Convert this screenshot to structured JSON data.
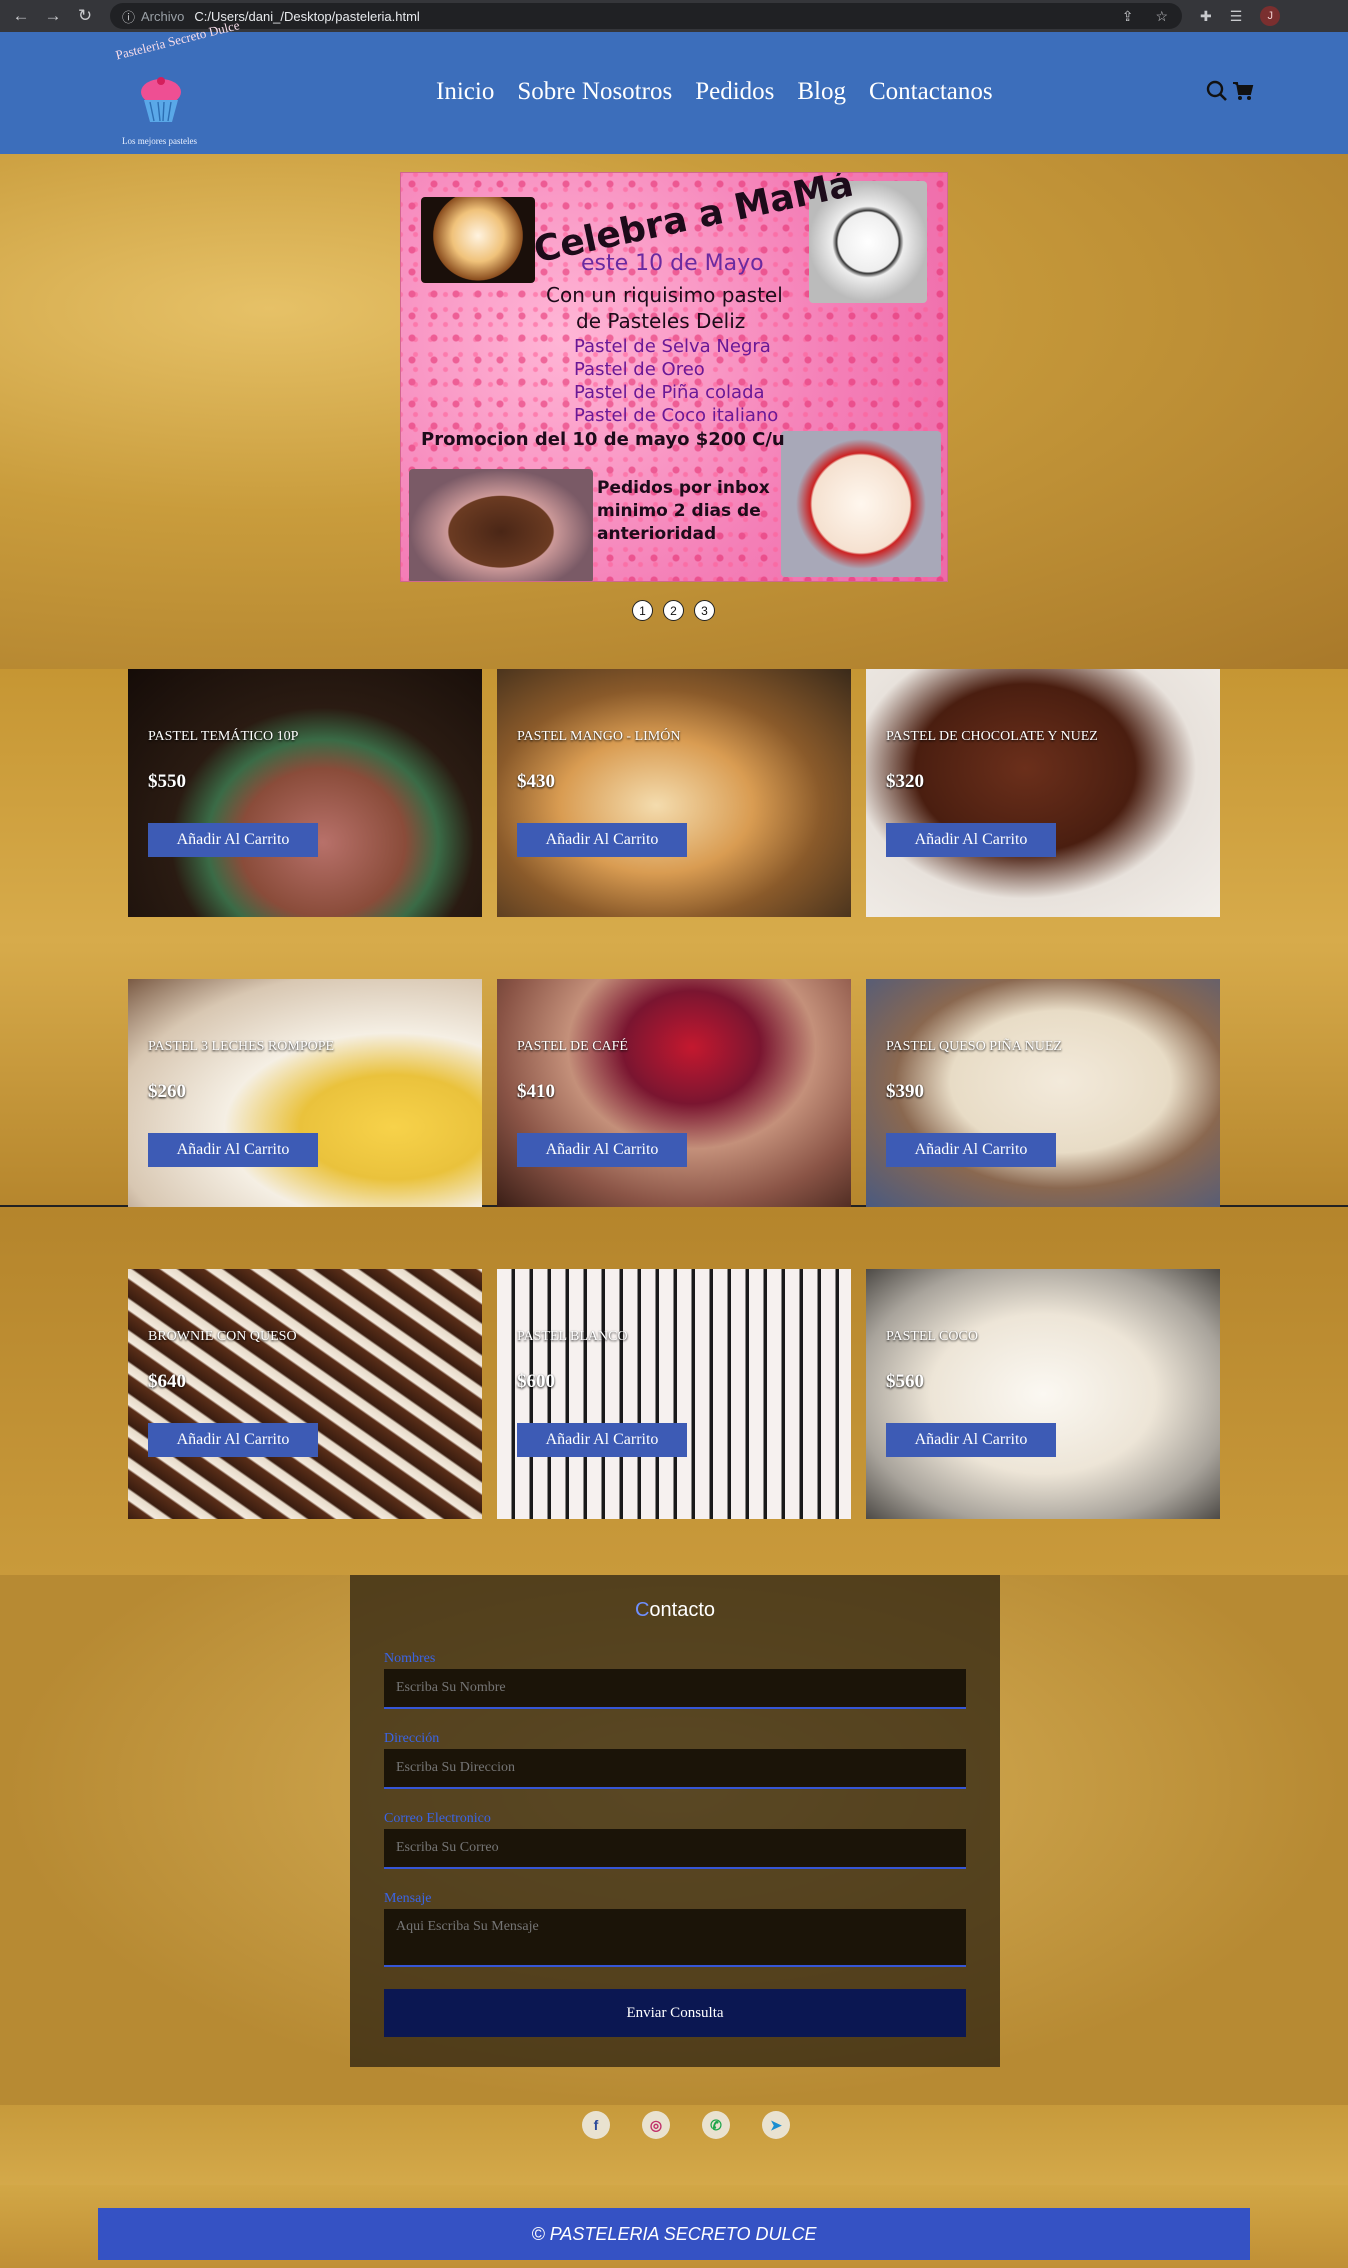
{
  "browser": {
    "archivo_label": "Archivo",
    "url": "C:/Users/dani_/Desktop/pasteleria.html",
    "avatar_letter": "J"
  },
  "header": {
    "logo_text": "Pasteleria Secreto Dulce",
    "logo_tagline": "Los mejores pasteles",
    "menu": [
      "Inicio",
      "Sobre Nosotros",
      "Pedidos",
      "Blog",
      "Contactanos"
    ],
    "icons": [
      "search-icon",
      "cart-icon"
    ]
  },
  "banner": {
    "title": "Celebra a MaMá",
    "date": "este 10 de Mayo",
    "line1": "Con un riquisimo pastel",
    "line2": "de Pasteles Deliz",
    "cakes": [
      "Pastel de Selva Negra",
      "Pastel de Oreo",
      "Pastel de Piña colada",
      "Pastel de Coco italiano"
    ],
    "promo": "Promocion del 10 de mayo $200 C/u",
    "pedidos": [
      "Pedidos por inbox",
      "minimo 2 dias de",
      "anterioridad"
    ],
    "dots": [
      "1",
      "2",
      "3"
    ]
  },
  "products": [
    {
      "name": "Pastel Temático 10P",
      "price": "$550",
      "button": "Añadir Al Carrito"
    },
    {
      "name": "Pastel Mango - Limón",
      "price": "$430",
      "button": "Añadir Al Carrito"
    },
    {
      "name": "Pastel de Chocolate y Nuez",
      "price": "$320",
      "button": "Añadir Al Carrito"
    },
    {
      "name": "Pastel 3 Leches Rompope",
      "price": "$260",
      "button": "Añadir Al Carrito"
    },
    {
      "name": "Pastel de Café",
      "price": "$410",
      "button": "Añadir Al Carrito"
    },
    {
      "name": "Pastel Queso Piña Nuez",
      "price": "$390",
      "button": "Añadir Al Carrito"
    },
    {
      "name": "Brownie con Queso",
      "price": "$640",
      "button": "Añadir Al Carrito"
    },
    {
      "name": "Pastel Blanco",
      "price": "$600",
      "button": "Añadir Al Carrito"
    },
    {
      "name": "Pastel Coco",
      "price": "$560",
      "button": "Añadir Al Carrito"
    }
  ],
  "contact": {
    "title_first": "C",
    "title_rest": "ontacto",
    "fields": [
      {
        "label": "Nombres",
        "placeholder": "Escriba Su Nombre"
      },
      {
        "label": "Dirección",
        "placeholder": "Escriba Su Direccion"
      },
      {
        "label": "Correo Electronico",
        "placeholder": "Escriba Su Correo"
      },
      {
        "label": "Mensaje",
        "placeholder": "Aqui Escriba Su Mensaje"
      }
    ],
    "submit": "Enviar Consulta"
  },
  "social": [
    "facebook-icon",
    "instagram-icon",
    "whatsapp-icon",
    "telegram-icon"
  ],
  "footer": {
    "text": "© PASTELERIA SECRETO DULCE"
  },
  "colors": {
    "header_bg": "#3c6ebb",
    "button_bg": "#3d5bb5",
    "submit_bg": "#0b1752",
    "footer_bg": "#3552c4",
    "label": "#3a64e6"
  }
}
